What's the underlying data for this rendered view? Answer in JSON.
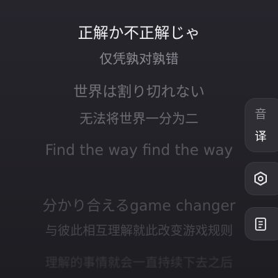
{
  "lyrics": [
    "正解か不正解じゃ",
    "仅凭孰对孰错",
    "世界は割り切れない",
    "无法将世界一分为二",
    "Find the way find the way",
    "分かり合えるgame changer",
    "与彼此相互理解就此改变游戏规则",
    "理解的事情就会一直持续下去之后"
  ],
  "side": {
    "lang_original": "音",
    "lang_translation": "译"
  },
  "icons": [
    "hexagon-nut-icon",
    "lyrics-card-icon"
  ]
}
